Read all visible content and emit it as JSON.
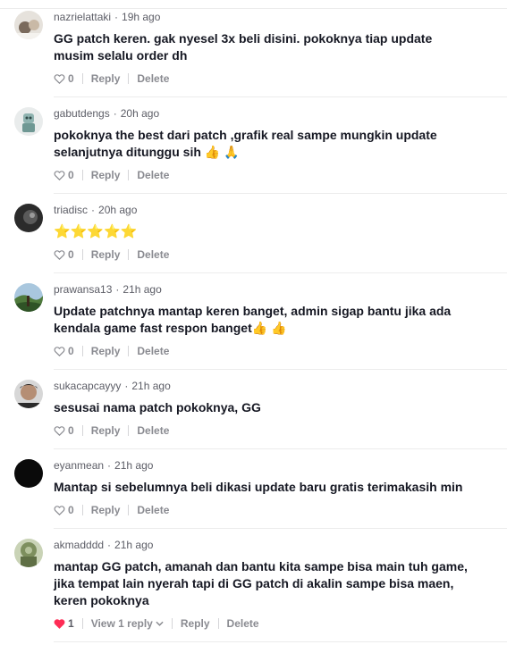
{
  "comments": [
    {
      "username": "nazrielattaki",
      "time": "19h ago",
      "text": "GG patch keren. gak nyesel 3x beli disini. pokoknya tiap update musim selalu order dh",
      "likes": "0",
      "reply_label": "Reply",
      "delete_label": "Delete"
    },
    {
      "username": "gabutdengs",
      "time": "20h ago",
      "text": "pokoknya the best dari patch ,grafik real sampe mungkin update selanjutnya ditunggu sih 👍 🙏",
      "likes": "0",
      "reply_label": "Reply",
      "delete_label": "Delete"
    },
    {
      "username": "triadisc",
      "time": "20h ago",
      "text": "⭐⭐⭐⭐⭐",
      "likes": "0",
      "reply_label": "Reply",
      "delete_label": "Delete"
    },
    {
      "username": "prawansa13",
      "time": "21h ago",
      "text": "Update patchnya mantap keren banget, admin sigap bantu jika ada kendala game fast respon banget👍 👍",
      "likes": "0",
      "reply_label": "Reply",
      "delete_label": "Delete"
    },
    {
      "username": "sukacapcayyy",
      "time": "21h ago",
      "text": "sesusai nama patch pokoknya, GG",
      "likes": "0",
      "reply_label": "Reply",
      "delete_label": "Delete"
    },
    {
      "username": "eyanmean",
      "time": "21h ago",
      "text": "Mantap si sebelumnya beli dikasi update baru gratis terimakasih min",
      "likes": "0",
      "reply_label": "Reply",
      "delete_label": "Delete"
    },
    {
      "username": "akmadddd",
      "time": "21h ago",
      "text": "mantap GG patch, amanah dan bantu kita sampe bisa main tuh game, jika tempat lain nyerah tapi di GG patch di akalin sampe bisa maen, keren pokoknya",
      "likes": "1",
      "view_replies_label": "View 1 reply",
      "reply_label": "Reply",
      "delete_label": "Delete"
    }
  ],
  "colors": {
    "liked_heart": "#fe2c55",
    "meta_text": "#5c5d66",
    "action_text": "#8a8b91"
  },
  "icons": {
    "like": "heart-outline-icon",
    "liked": "heart-filled-icon",
    "expand": "chevron-down-icon"
  }
}
